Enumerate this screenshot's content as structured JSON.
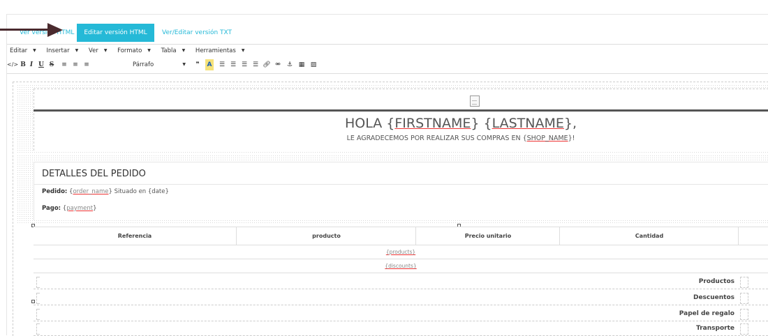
{
  "tabs": {
    "view_html": "Ver versión HTML",
    "edit_html": "Editar versión HTML",
    "edit_txt": "Ver/Editar versión TXT"
  },
  "menubar": [
    "Editar",
    "Insertar",
    "Ver",
    "Formato",
    "Tabla",
    "Herramientas"
  ],
  "toolbar": {
    "source": "</>",
    "bold": "B",
    "italic": "I",
    "underline": "U",
    "strike": "S",
    "format_select": "Párrafo",
    "icons": [
      "bold-icon",
      "italic-icon",
      "underline-icon",
      "strikethrough-icon",
      "align-left-icon",
      "align-center-icon",
      "align-right-icon",
      "blockquote-icon",
      "text-color-icon",
      "bullet-list-icon",
      "numbered-list-icon",
      "outdent-icon",
      "indent-icon",
      "link-icon",
      "unlink-icon",
      "anchor-icon",
      "media-icon",
      "image-icon"
    ]
  },
  "email": {
    "greeting_prefix": "HOLA {",
    "firstname": "FIRSTNAME",
    "greeting_mid": "} {",
    "lastname": "LASTNAME",
    "greeting_suffix": "},",
    "thanks_prefix": "LE AGRADECEMOS POR REALIZAR SUS COMPRAS EN {",
    "shop_name": "SHOP_NAME",
    "thanks_suffix": "}!",
    "details_title": "DETALLES DEL PEDIDO",
    "order_label": "Pedido:",
    "order_open": " {",
    "order_name": "order_name",
    "order_rest": "} Situado en {date}",
    "payment_label": "Pago:",
    "payment_open": " {",
    "payment": "payment",
    "payment_close": "}"
  },
  "table": {
    "headers": [
      "Referencia",
      "producto",
      "Precio unitario",
      "Cantidad"
    ],
    "rows": [
      "{products}",
      "{discounts}"
    ],
    "totals": [
      "Productos",
      "Descuentos",
      "Papel de regalo",
      "Transporte"
    ]
  },
  "colors": {
    "accent": "#25b9d7",
    "arrow": "#4a2a2e"
  }
}
